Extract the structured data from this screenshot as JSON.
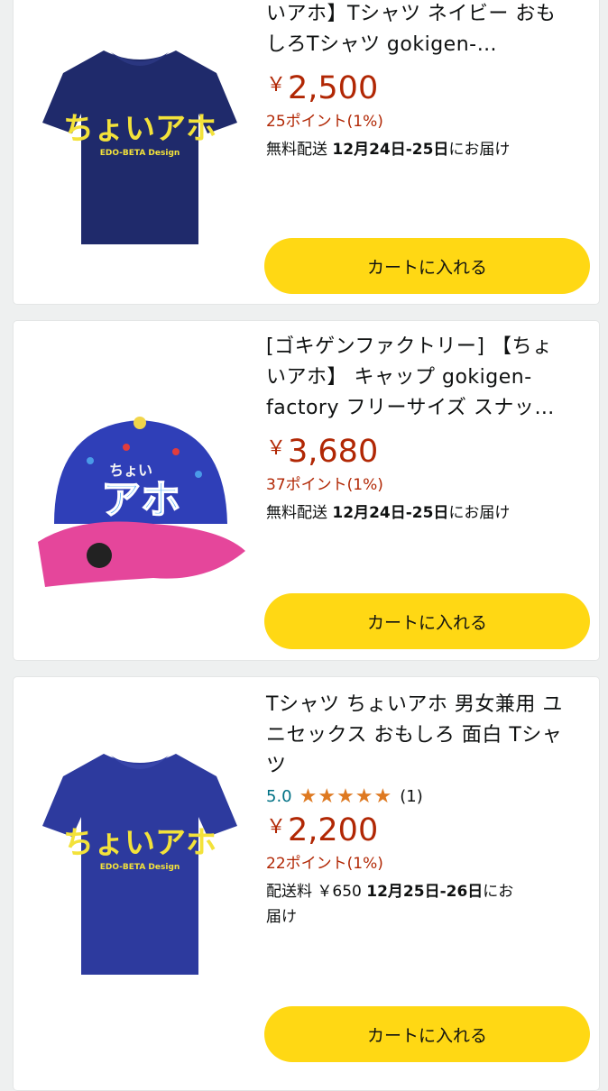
{
  "products": [
    {
      "title_lines": [
        "いアホ】Tシャツ ネイビー おも",
        "しろTシャツ gokigen-…"
      ],
      "price_symbol": "￥",
      "price": "2,500",
      "points": "25ポイント(1%)",
      "delivery_prefix": "無料配送 ",
      "delivery_date": "12月24日-25日",
      "delivery_suffix": "にお届け",
      "cart_label": "カートに入れる",
      "image_text": "ちょいアホ",
      "image_subtext": "EDO-BETA Design"
    },
    {
      "title_lines": [
        "[ゴキゲンファクトリー] 【ちょ",
        "いアホ】 キャップ gokigen-",
        "factory フリーサイズ スナッ…"
      ],
      "price_symbol": "￥",
      "price": "3,680",
      "points": "37ポイント(1%)",
      "delivery_prefix": "無料配送 ",
      "delivery_date": "12月24日-25日",
      "delivery_suffix": "にお届け",
      "cart_label": "カートに入れる",
      "image_text_top": "ちょい",
      "image_text_main": "アホ"
    },
    {
      "title_lines": [
        "Tシャツ ちょいアホ 男女兼用 ユ",
        "ニセックス おもしろ 面白 Tシャ",
        "ツ"
      ],
      "rating_value": "5.0",
      "rating_stars": "★★★★★",
      "rating_count": "(1)",
      "price_symbol": "￥",
      "price": "2,200",
      "points": "22ポイント(1%)",
      "delivery_line1_prefix": "配送料 ￥650 ",
      "delivery_line1_date": "12月25日-26日",
      "delivery_line1_suffix": "にお",
      "delivery_line2": "届け",
      "cart_label": "カートに入れる",
      "image_text": "ちょいアホ",
      "image_subtext": "EDO-BETA Design"
    }
  ],
  "colors": {
    "price": "#b12704",
    "cart_button": "#ffd814",
    "rating_link": "#007185",
    "stars": "#de7921",
    "navy_shirt": "#1f2a6b",
    "royal_shirt": "#2d3a9e",
    "cap_blue": "#2f3fb8",
    "cap_pink": "#e5469b"
  }
}
